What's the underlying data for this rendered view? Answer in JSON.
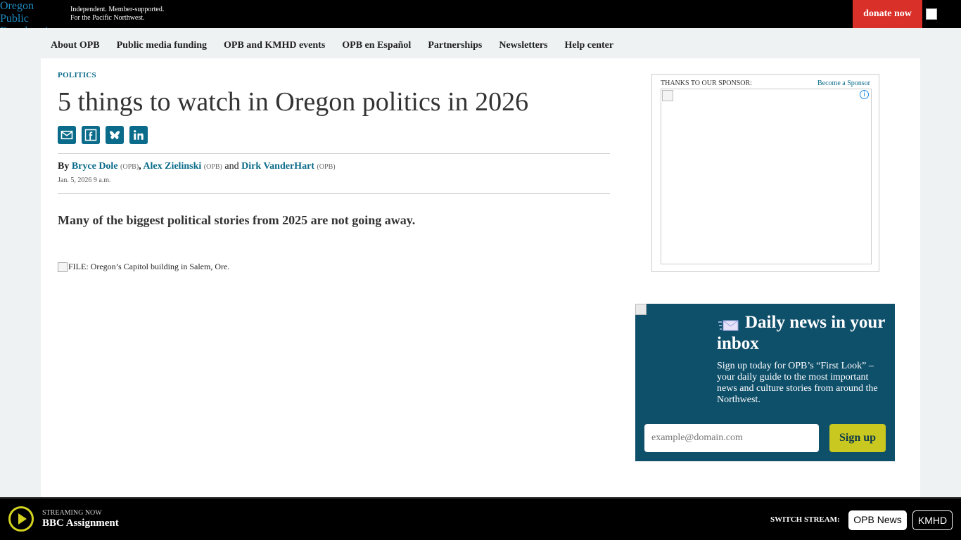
{
  "header": {
    "logo_alt": "Oregon Public Broadcasting",
    "tagline_line1": "Independent. Member-supported.",
    "tagline_line2": "For the Pacific Northwest.",
    "donate_label": "donate now"
  },
  "nav": {
    "items": [
      "About OPB",
      "Public media funding",
      "OPB and KMHD events",
      "OPB en Español",
      "Partnerships",
      "Newsletters",
      "Help center"
    ]
  },
  "article": {
    "section": "POLITICS",
    "headline": "5 things to watch in Oregon politics in 2026",
    "share_icons": [
      "email-icon",
      "facebook-icon",
      "bluesky-icon",
      "linkedin-icon"
    ],
    "byline": {
      "by": "By",
      "authors": [
        {
          "name": "Bryce Dole",
          "org": "(OPB)"
        },
        {
          "name": "Alex Zielinski",
          "org": "(OPB)"
        },
        {
          "name": "Dirk VanderHart",
          "org": "(OPB)"
        }
      ],
      "and": "and"
    },
    "date": "Jan. 5, 2026 9 a.m.",
    "dek": "Many of the biggest political stories from 2025 are not going away.",
    "photo_alt": "FILE: Oregon’s Capitol building in Salem, Ore."
  },
  "sponsor": {
    "label": "THANKS TO OUR SPONSOR:",
    "become_label": "Become a Sponsor"
  },
  "newsletter": {
    "title": "Daily news in your inbox",
    "description": "Sign up today for OPB’s “First Look” – your daily guide to the most important news and culture stories from around the Northwest.",
    "email_placeholder": "example@domain.com",
    "signup_label": "Sign up"
  },
  "stream": {
    "label": "STREAMING NOW",
    "title": "BBC Assignment",
    "switch_label": "SWITCH STREAM:",
    "options": [
      "OPB News",
      "KMHD"
    ],
    "active": "OPB News"
  },
  "colors": {
    "accent": "#0a6b8a",
    "donate": "#d9312a",
    "newsletter_bg": "#0e4f6a",
    "signup_button": "#c8c820"
  }
}
